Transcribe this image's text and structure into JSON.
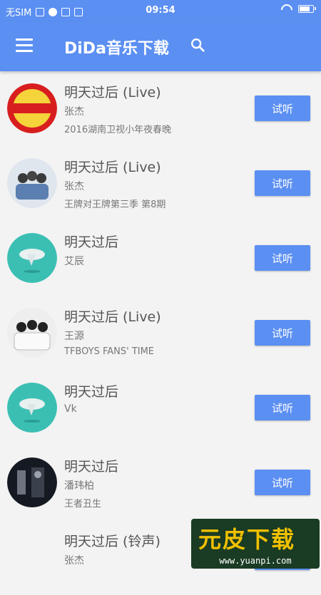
{
  "status_bar": {
    "carrier": "无SIM",
    "time": "09:54",
    "battery_level": 0.9
  },
  "app_bar": {
    "title": "DiDa音乐下载",
    "menu_icon": "menu-icon",
    "search_icon": "search-icon"
  },
  "songs": [
    {
      "title": "明天过后 (Live)",
      "artist": "张杰",
      "album": "2016湖南卫视小年夜春晚",
      "button": "试听",
      "cover": "red-logo-cover"
    },
    {
      "title": "明天过后 (Live)",
      "artist": "张杰",
      "album": "王牌对王牌第三季 第8期",
      "button": "试听",
      "cover": "group-photo-cover"
    },
    {
      "title": "明天过后",
      "artist": "艾辰",
      "album": "",
      "button": "试听",
      "cover": "default-teal-cover"
    },
    {
      "title": "明天过后 (Live)",
      "artist": "王源",
      "album": "TFBOYS FANS' TIME",
      "button": "试听",
      "cover": "group-photo-cover"
    },
    {
      "title": "明天过后",
      "artist": "Vk",
      "album": "",
      "button": "试听",
      "cover": "default-teal-cover"
    },
    {
      "title": "明天过后",
      "artist": "潘玮柏",
      "album": "王者丑生",
      "button": "试听",
      "cover": "dark-poster-cover"
    },
    {
      "title": "明天过后 (铃声)",
      "artist": "张杰",
      "album": "",
      "button": "试听",
      "cover": "none"
    }
  ],
  "watermark": {
    "text": "元皮下载",
    "url": "www.yuanpi.com"
  },
  "colors": {
    "primary": "#5b8ff2",
    "background": "#f3f3f3",
    "teal": "#3bbfb3"
  }
}
